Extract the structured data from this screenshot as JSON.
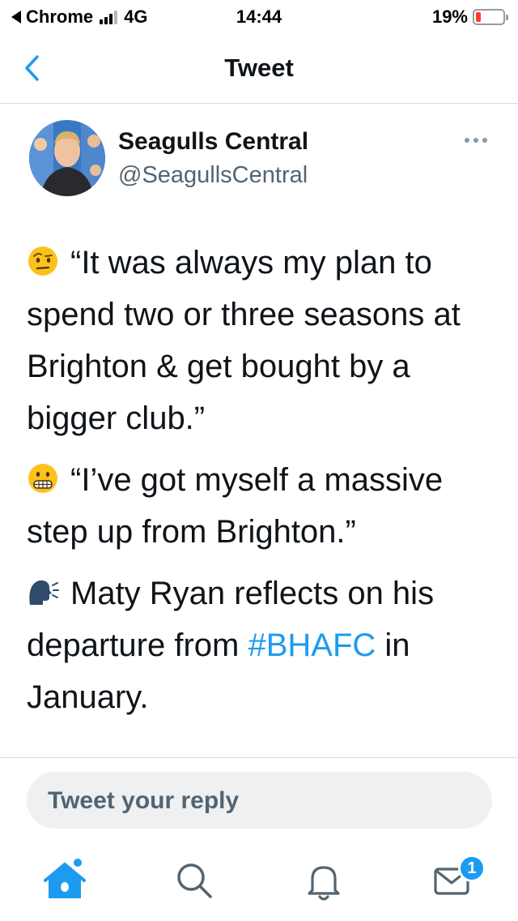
{
  "status_bar": {
    "back_app": "Chrome",
    "network": "4G",
    "time": "14:44",
    "battery_percent": "19%",
    "battery_level": 0.19,
    "battery_color": "#ff3b30"
  },
  "header": {
    "title": "Tweet",
    "back_icon": "chevron-left-icon"
  },
  "tweet": {
    "author_name": "Seagulls Central",
    "author_handle": "@SeagullsCentral",
    "paragraphs": [
      {
        "emoji": "raised-eyebrow-emoji",
        "text": "“It was always my plan to spend two or three seasons at Brighton & get bought by a bigger club.”"
      },
      {
        "emoji": "grimacing-face-emoji",
        "text": "“I’ve got myself a massive step up from Brighton.”"
      },
      {
        "emoji": "speaking-head-emoji",
        "text_before": "Maty Ryan reflects on his departure from ",
        "hashtag": "#BHAFC",
        "text_after": " in January."
      }
    ]
  },
  "reply": {
    "placeholder": "Tweet your reply"
  },
  "tabbar": {
    "items": [
      "home-icon",
      "search-icon",
      "bell-icon",
      "mail-icon"
    ],
    "messages_badge": "1"
  },
  "colors": {
    "accent": "#1d9bf0",
    "text": "#0f1419",
    "secondary": "#536471"
  }
}
